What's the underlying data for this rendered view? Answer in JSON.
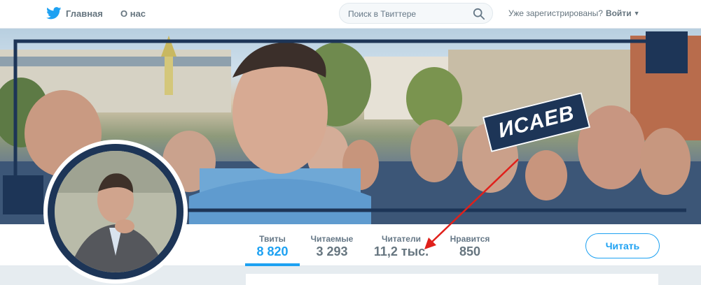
{
  "nav": {
    "home_label": "Главная",
    "about_label": "О нас"
  },
  "search": {
    "placeholder": "Поиск в Твиттере"
  },
  "login": {
    "prompt": "Уже зарегистрированы?",
    "signin_label": "Войти"
  },
  "banner": {
    "logo_text": "ИСАЕВ"
  },
  "stats": [
    {
      "label": "Твиты",
      "value": "8 820",
      "active": true
    },
    {
      "label": "Читаемые",
      "value": "3 293",
      "active": false
    },
    {
      "label": "Читатели",
      "value": "11,2 тыс.",
      "active": false
    },
    {
      "label": "Нравится",
      "value": "850",
      "active": false
    }
  ],
  "follow_label": "Читать",
  "colors": {
    "accent": "#1da1f2",
    "banner_navy": "#1d3557",
    "annotation_arrow": "#e0201b"
  },
  "icons": {
    "brand": "twitter-bird-icon",
    "search": "search-icon",
    "caret": "caret-down-icon"
  }
}
